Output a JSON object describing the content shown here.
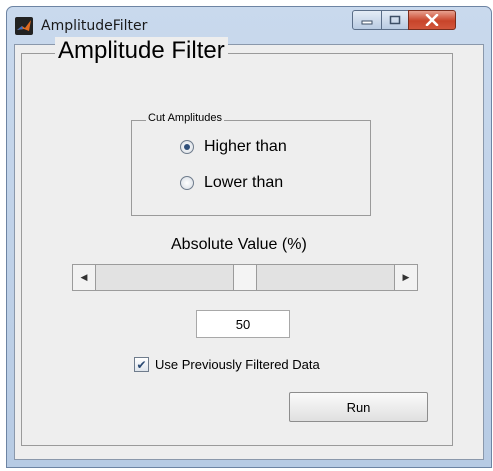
{
  "window": {
    "title": "AmplitudeFilter",
    "controls": {
      "minimize_icon": "minimize-icon",
      "maximize_icon": "maximize-icon",
      "close_label": "X"
    },
    "colors": {
      "titlebar": "#c9d9ed",
      "close_button": "#c8442a",
      "client_background": "#eeeeee"
    }
  },
  "panel": {
    "title": "Amplitude Filter"
  },
  "cut_amplitudes": {
    "title": "Cut Amplitudes",
    "options": [
      {
        "label": "Higher than",
        "selected": true
      },
      {
        "label": "Lower than",
        "selected": false
      }
    ]
  },
  "absolute_value": {
    "label": "Absolute Value (%)",
    "slider_value": 50,
    "slider_min": 0,
    "slider_max": 100,
    "input_value": "50"
  },
  "use_previous": {
    "label": "Use Previously Filtered Data",
    "checked": true,
    "check_glyph": "✔"
  },
  "run_button": {
    "label": "Run"
  }
}
